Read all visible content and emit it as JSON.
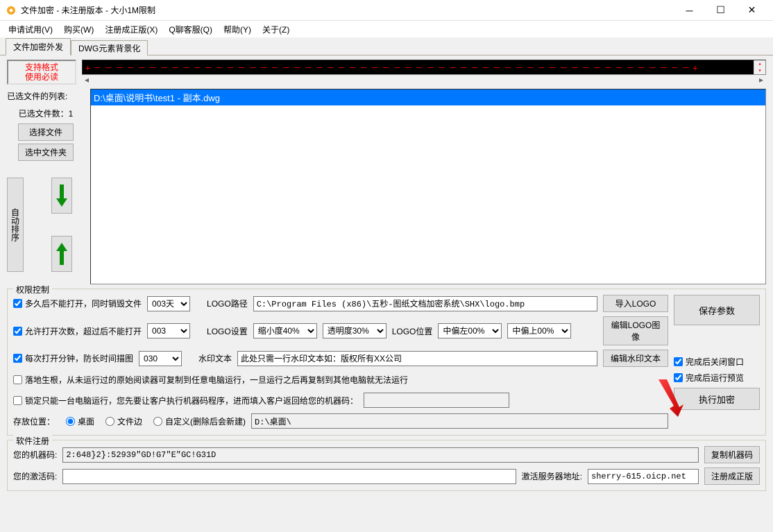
{
  "window": {
    "title": "文件加密 - 未注册版本 - 大小1M限制"
  },
  "menu": {
    "apply": "申请试用(V)",
    "buy": "购买(W)",
    "register": "注册成正版(X)",
    "qservice": "Q聊客服(Q)",
    "help": "帮助(Y)",
    "about": "关于(Z)"
  },
  "tabs": {
    "tab1": "文件加密外发",
    "tab2": "DWG元素背景化"
  },
  "topbtn": {
    "line1": "支持格式",
    "line2": "使用必读"
  },
  "banner": "+－－－－－－－－－－－－－－－－－－－－－－－－－－－－－－－－－－－－－－－－－－－－－－－－－－－－－－+",
  "filelist": {
    "label": "已选文件的列表:",
    "countlabel": "已选文件数：1",
    "btn_select_file": "选择文件",
    "btn_select_folder": "选中文件夹",
    "btn_sort": "自动排序",
    "items": [
      "D:\\桌面\\说明书\\test1 - 副本.dwg"
    ]
  },
  "perm": {
    "legend": "权限控制",
    "days_label": "多久后不能打开，同时销毁文件",
    "days_value": "003天",
    "logo_path_label": "LOGO路径",
    "logo_path_value": "C:\\Program Files (x86)\\五秒-图纸文档加密系统\\SHX\\logo.bmp",
    "btn_import_logo": "导入LOGO",
    "open_count_label": "允许打开次数，超过后不能打开",
    "open_count_value": "003",
    "logo_set_label": "LOGO设置",
    "scale_value": "缩小度40%",
    "trans_value": "透明度30%",
    "logo_pos_label": "LOGO位置",
    "offset_left_value": "中偏左00%",
    "offset_up_value": "中偏上00%",
    "btn_edit_logo": "编辑LOGO图像",
    "minutes_label": "每次打开分钟，防长时间描图",
    "minutes_value": "030",
    "watermark_label": "水印文本",
    "watermark_value": "此处只需一行水印文本如：版权所有XX公司",
    "btn_edit_watermark": "编辑水印文本",
    "root_label": "落地生根，从未运行过的原始阅读器可复制到任意电脑运行，一旦运行之后再复制到其他电脑就无法运行",
    "lock_label": "锁定只能一台电脑运行，您先要让客户执行机器码程序，进而填入客户返回给您的机器码：",
    "save_loc_label": "存放位置：",
    "radio_desktop": "桌面",
    "radio_fileside": "文件边",
    "radio_custom": "自定义(删除后会新建)",
    "save_path_value": "D:\\桌面\\",
    "btn_save_params": "保存参数",
    "chk_close": "完成后关闭窗口",
    "chk_preview": "完成后运行预览",
    "btn_execute": "执行加密"
  },
  "reg": {
    "legend": "软件注册",
    "machine_label": "您的机器码:",
    "machine_value": "2:648}2}:52939\"GD!G7\"E\"GC!G31D",
    "btn_copy": "复制机器码",
    "activate_label": "您的激活码:",
    "server_label": "激活服务器地址:",
    "server_value": "sherry-615.oicp.net",
    "btn_register": "注册成正版"
  }
}
